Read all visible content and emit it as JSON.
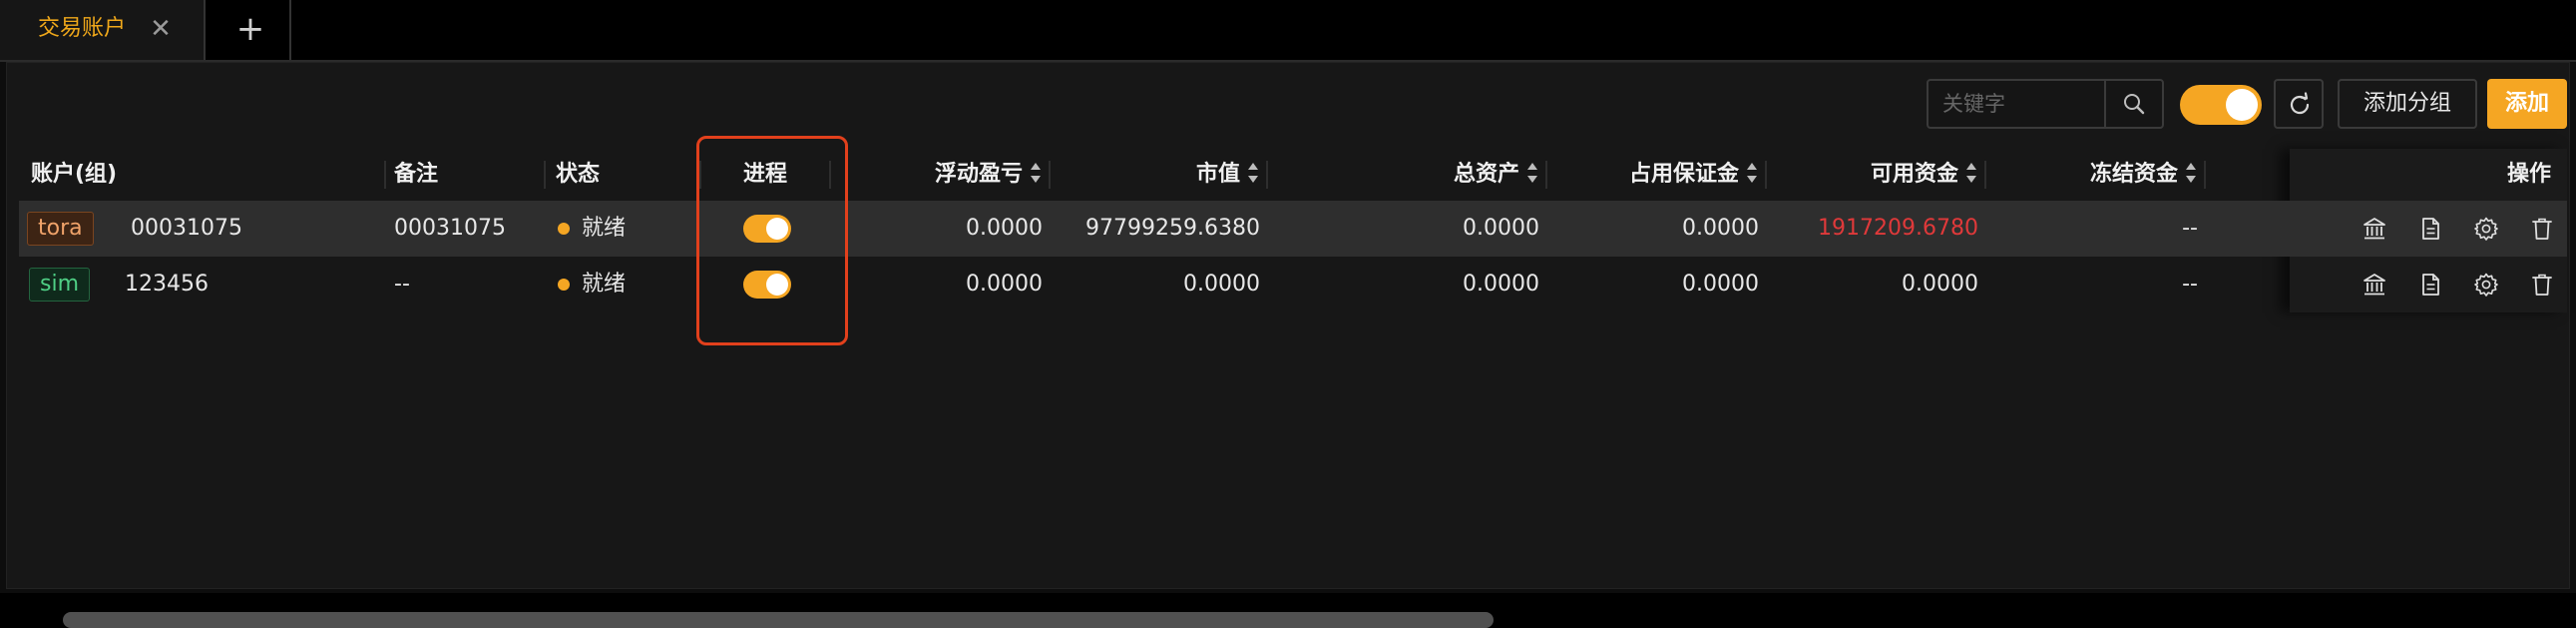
{
  "tabs": {
    "active_label": "交易账户",
    "close_glyph": "✕",
    "add_glyph": "+"
  },
  "toolbar": {
    "search_placeholder": "关键字",
    "process_toggle_on": true,
    "add_group_label": "添加分组",
    "add_label": "添加"
  },
  "table": {
    "headers": {
      "account": "账户(组)",
      "note": "备注",
      "status": "状态",
      "process": "进程",
      "floating_pnl": "浮动盈亏",
      "market_value": "市值",
      "total_assets": "总资产",
      "margin_used": "占用保证金",
      "available": "可用资金",
      "frozen": "冻结资金",
      "actions": "操作"
    },
    "rows": [
      {
        "tag": "tora",
        "account": "00031075",
        "note": "00031075",
        "status": "就绪",
        "process_on": true,
        "floating_pnl": "0.0000",
        "market_value": "97799259.6380",
        "total_assets": "0.0000",
        "margin_used": "0.0000",
        "available": "1917209.6780",
        "frozen": "--"
      },
      {
        "tag": "sim",
        "account": "123456",
        "note": "--",
        "status": "就绪",
        "process_on": true,
        "floating_pnl": "0.0000",
        "market_value": "0.0000",
        "total_assets": "0.0000",
        "margin_used": "0.0000",
        "available": "0.0000",
        "frozen": "--"
      }
    ],
    "row_action_icons": [
      "bank-icon",
      "document-icon",
      "gear-icon",
      "trash-icon"
    ]
  },
  "colors": {
    "accent": "#f5a623",
    "negative": "#e0393a",
    "highlight_box": "#e2401c",
    "tag_tora": "#f0a36a",
    "tag_sim": "#4fcf85"
  }
}
